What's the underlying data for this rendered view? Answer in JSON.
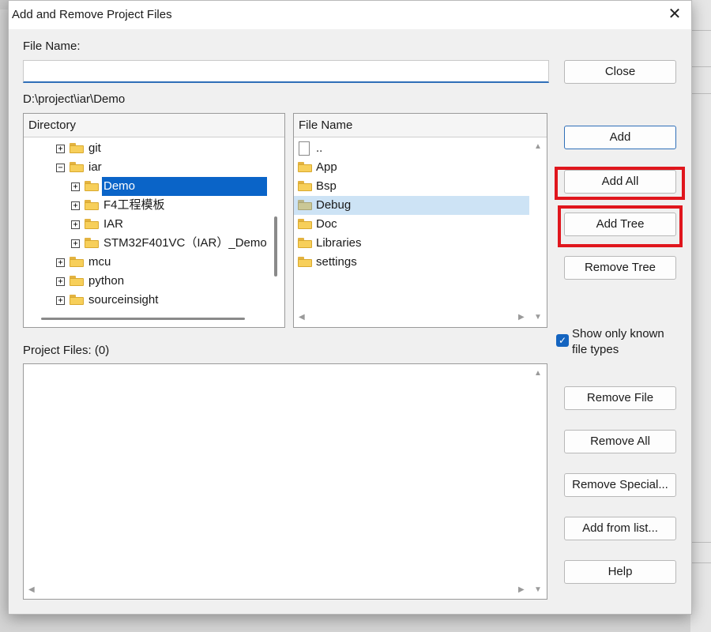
{
  "dialog": {
    "title": "Add and Remove Project Files",
    "close_symbol": "✕"
  },
  "file_name": {
    "label": "File Name:",
    "value": ""
  },
  "current_path": "D:\\project\\iar\\Demo",
  "directory_tree": {
    "header": "Directory",
    "items": [
      {
        "label": "git",
        "expander": "+"
      },
      {
        "label": "iar",
        "expander": "−"
      },
      {
        "label": "Demo",
        "expander": "+",
        "selected": true
      },
      {
        "label": "F4工程模板",
        "expander": "+"
      },
      {
        "label": "IAR",
        "expander": "+"
      },
      {
        "label": "STM32F401VC（IAR）_Demo",
        "expander": "+"
      },
      {
        "label": "mcu",
        "expander": "+"
      },
      {
        "label": "python",
        "expander": "+"
      },
      {
        "label": "sourceinsight",
        "expander": "+"
      }
    ]
  },
  "file_list": {
    "header": "File Name",
    "items": [
      {
        "label": "..",
        "icon": "file-icon"
      },
      {
        "label": "App",
        "icon": "folder-icon"
      },
      {
        "label": "Bsp",
        "icon": "folder-icon"
      },
      {
        "label": "Debug",
        "icon": "folder-icon",
        "selected": true
      },
      {
        "label": "Doc",
        "icon": "folder-icon"
      },
      {
        "label": "Libraries",
        "icon": "folder-icon"
      },
      {
        "label": "settings",
        "icon": "folder-icon"
      }
    ]
  },
  "project_files": {
    "label": "Project Files: (0)"
  },
  "buttons": {
    "close": "Close",
    "add": "Add",
    "add_all": "Add All",
    "add_tree": "Add Tree",
    "remove_tree": "Remove Tree",
    "remove_file": "Remove File",
    "remove_all": "Remove All",
    "remove_special": "Remove Special...",
    "add_from_list": "Add from list...",
    "help": "Help"
  },
  "options": {
    "show_known_types_line1": "Show only known",
    "show_known_types_line2": "file types",
    "show_known_types_checked": true
  },
  "highlight_color": "#e0161d",
  "selection_color": "#0a64c8"
}
